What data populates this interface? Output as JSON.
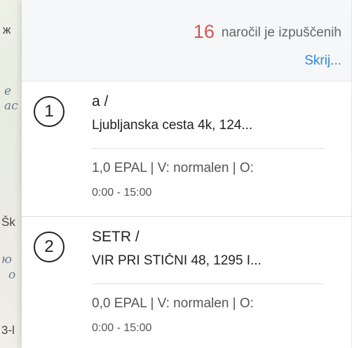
{
  "map": {
    "fragments": [
      "ж",
      "е",
      "ас",
      "Šk",
      "ю",
      "о",
      "3-l"
    ]
  },
  "summary": {
    "count": "16",
    "text": "naročil je izpuščenih",
    "hide_label": "Skrij..."
  },
  "orders": [
    {
      "number": "1",
      "title": "a /",
      "address": "Ljubljanska cesta 4k, 124...",
      "meta": "1,0 EPAL | V: normalen | O:",
      "time": "0:00 - 15:00"
    },
    {
      "number": "2",
      "title": "SETR /",
      "address": "VIR PRI STIČNI 48, 1295 I...",
      "meta": "0,0 EPAL | V: normalen | O:",
      "time": "0:00 - 15:00"
    }
  ],
  "colors": {
    "count": "#d9534f",
    "link": "#2c88d9",
    "panel_header_bg": "#f5f7f9"
  }
}
